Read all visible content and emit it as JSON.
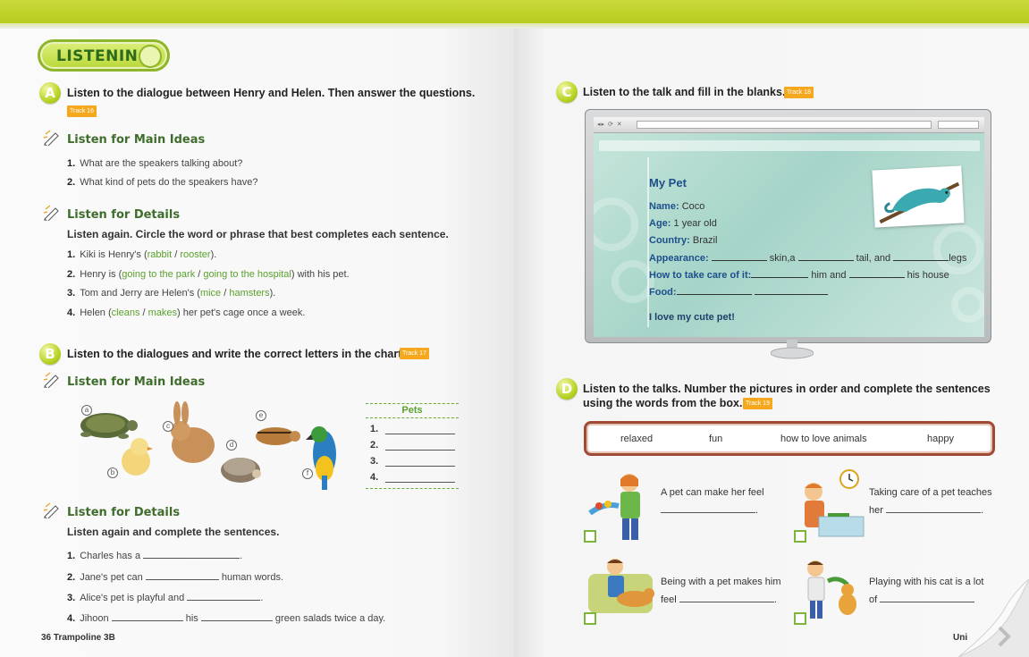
{
  "left_page": {
    "section_title": "LISTENING",
    "a": {
      "letter": "A",
      "instruction": "Listen to the dialogue between Henry and Helen. Then answer the questions.",
      "track": "Track 16",
      "main_ideas": {
        "heading": "Listen for Main Ideas",
        "questions": [
          {
            "num": "1.",
            "text": "What are the speakers talking about?"
          },
          {
            "num": "2.",
            "text": "What kind of pets do the speakers have?"
          }
        ]
      },
      "details": {
        "heading": "Listen for Details",
        "instruction": "Listen again. Circle the word or phrase that best completes each sentence.",
        "items": [
          {
            "num": "1.",
            "pre": "Kiki is Henry's (",
            "opt1": "rabbit",
            "sep": " / ",
            "opt2": "rooster",
            "post": ")."
          },
          {
            "num": "2.",
            "pre": "Henry is (",
            "opt1": "going to the park",
            "sep": " / ",
            "opt2": "going to the hospital",
            "post": ") with his pet."
          },
          {
            "num": "3.",
            "pre": "Tom and Jerry are Helen's (",
            "opt1": "mice",
            "sep": " / ",
            "opt2": "hamsters",
            "post": ")."
          },
          {
            "num": "4.",
            "pre": "Helen (",
            "opt1": "cleans",
            "sep": " / ",
            "opt2": "makes",
            "post": ") her pet's cage once a week."
          }
        ]
      }
    },
    "b": {
      "letter": "B",
      "instruction": "Listen to the dialogues and write the correct letters in the chart.",
      "track": "Track 17",
      "main_ideas_heading": "Listen for Main Ideas",
      "animal_labels": [
        "a",
        "b",
        "c",
        "d",
        "e",
        "f"
      ],
      "pets_header": "Pets",
      "pets_rows": [
        "1.",
        "2.",
        "3.",
        "4."
      ],
      "details": {
        "heading": "Listen for Details",
        "instruction": "Listen again and complete the sentences.",
        "items": [
          {
            "num": "1.",
            "a": "Charles has a",
            "b": ".",
            "c": "",
            "d": ""
          },
          {
            "num": "2.",
            "a": "Jane's pet can",
            "b": "human words.",
            "c": "",
            "d": ""
          },
          {
            "num": "3.",
            "a": "Alice's pet is playful and",
            "b": ".",
            "c": "",
            "d": ""
          },
          {
            "num": "4.",
            "a": "Jihoon",
            "b": "his",
            "c": "green salads twice a day.",
            "d": ""
          }
        ]
      }
    },
    "footer": "36 Trampoline 3B"
  },
  "right_page": {
    "c": {
      "letter": "C",
      "instruction": "Listen to the talk and fill in the blanks.",
      "track": "Track 18",
      "card": {
        "title": "My Pet",
        "name_label": "Name:",
        "name_value": "Coco",
        "age_label": "Age:",
        "age_value": "1 year old",
        "country_label": "Country:",
        "country_value": "Brazil",
        "appearance_label": "Appearance:",
        "appearance_t1": "skin,a",
        "appearance_t2": "tail, and",
        "appearance_t3": "legs",
        "care_label": "How to take care of it:",
        "care_t1": "him and",
        "care_t2": "his house",
        "food_label": "Food:",
        "closing": "I love my cute pet!"
      }
    },
    "d": {
      "letter": "D",
      "instruction_line1": "Listen to the talks. Number the pictures in order and complete the sentences",
      "instruction_line2": "using the words from the box.",
      "track": "Track 19",
      "words": [
        "relaxed",
        "fun",
        "how to love animals",
        "happy"
      ],
      "sentences": [
        {
          "l1": "A pet can make her feel",
          "l2_post": "."
        },
        {
          "l1": "Taking care of a pet teaches",
          "l2_pre": "her",
          "l2_post": "."
        },
        {
          "l1": "Being with a pet makes him",
          "l2_pre": "feel",
          "l2_post": "."
        },
        {
          "l1": "Playing with his cat is a lot",
          "l2_pre": "of",
          "l2_post": ""
        }
      ]
    },
    "footer": "Uni"
  },
  "colors": {
    "top_bar": "#b6cc1e",
    "heading_green": "#3f6d2c",
    "option_green": "#5aa12d",
    "track_orange": "#f5a81e",
    "card_blue": "#1e4f8a",
    "word_box_border": "#a04a36"
  }
}
